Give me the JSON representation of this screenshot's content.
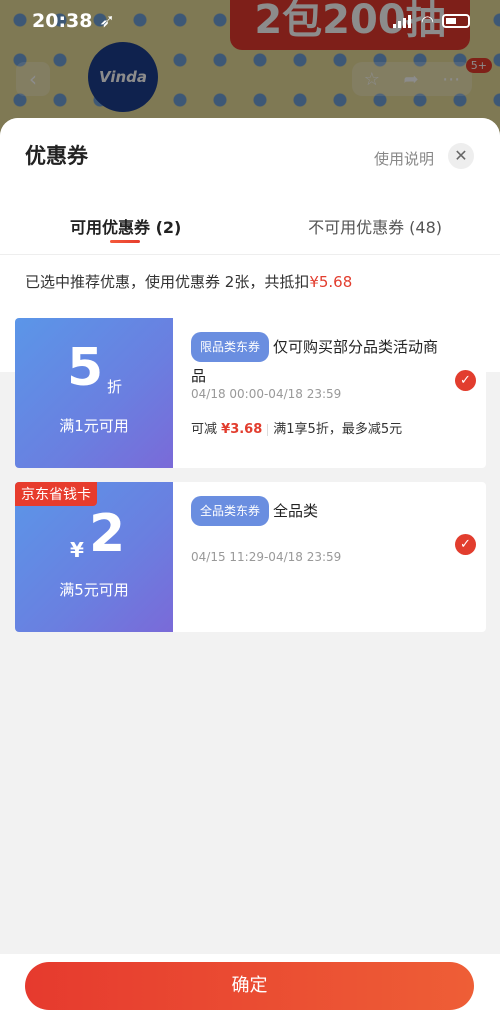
{
  "status_bar": {
    "time": "20:38 ➶"
  },
  "background": {
    "banner_text": "2包200抽",
    "logo_text": "Vinda",
    "badge": "5+"
  },
  "sheet": {
    "title": "优惠券",
    "help": "使用说明",
    "tabs": [
      {
        "label": "可用优惠券 (2)",
        "active": true
      },
      {
        "label": "不可用优惠券 (48)",
        "active": false
      }
    ],
    "summary_prefix": "已选中推荐优惠，使用优惠券 2张，共抵扣",
    "summary_amount": "¥5.68"
  },
  "coupons": [
    {
      "value": "5",
      "unit": "折",
      "condition": "满1元可用",
      "chip": "限品类东券",
      "title": "仅可购买部分品类活动商品",
      "date": "04/18 00:00-04/18 23:59",
      "save_label": "可减",
      "save_amount": "¥3.68",
      "rule": "满1享5折，最多减5元",
      "selected": true
    },
    {
      "tag": "京东省钱卡",
      "symbol": "¥",
      "value": "2",
      "condition": "满5元可用",
      "chip": "全品类东券",
      "title": "全品类",
      "date": "04/15 11:29-04/18 23:59",
      "selected": true
    }
  ],
  "footer": {
    "confirm_label": "确定"
  },
  "colors": {
    "accent": "#e23d2e",
    "coupon_blue": "#6a8ee0"
  }
}
